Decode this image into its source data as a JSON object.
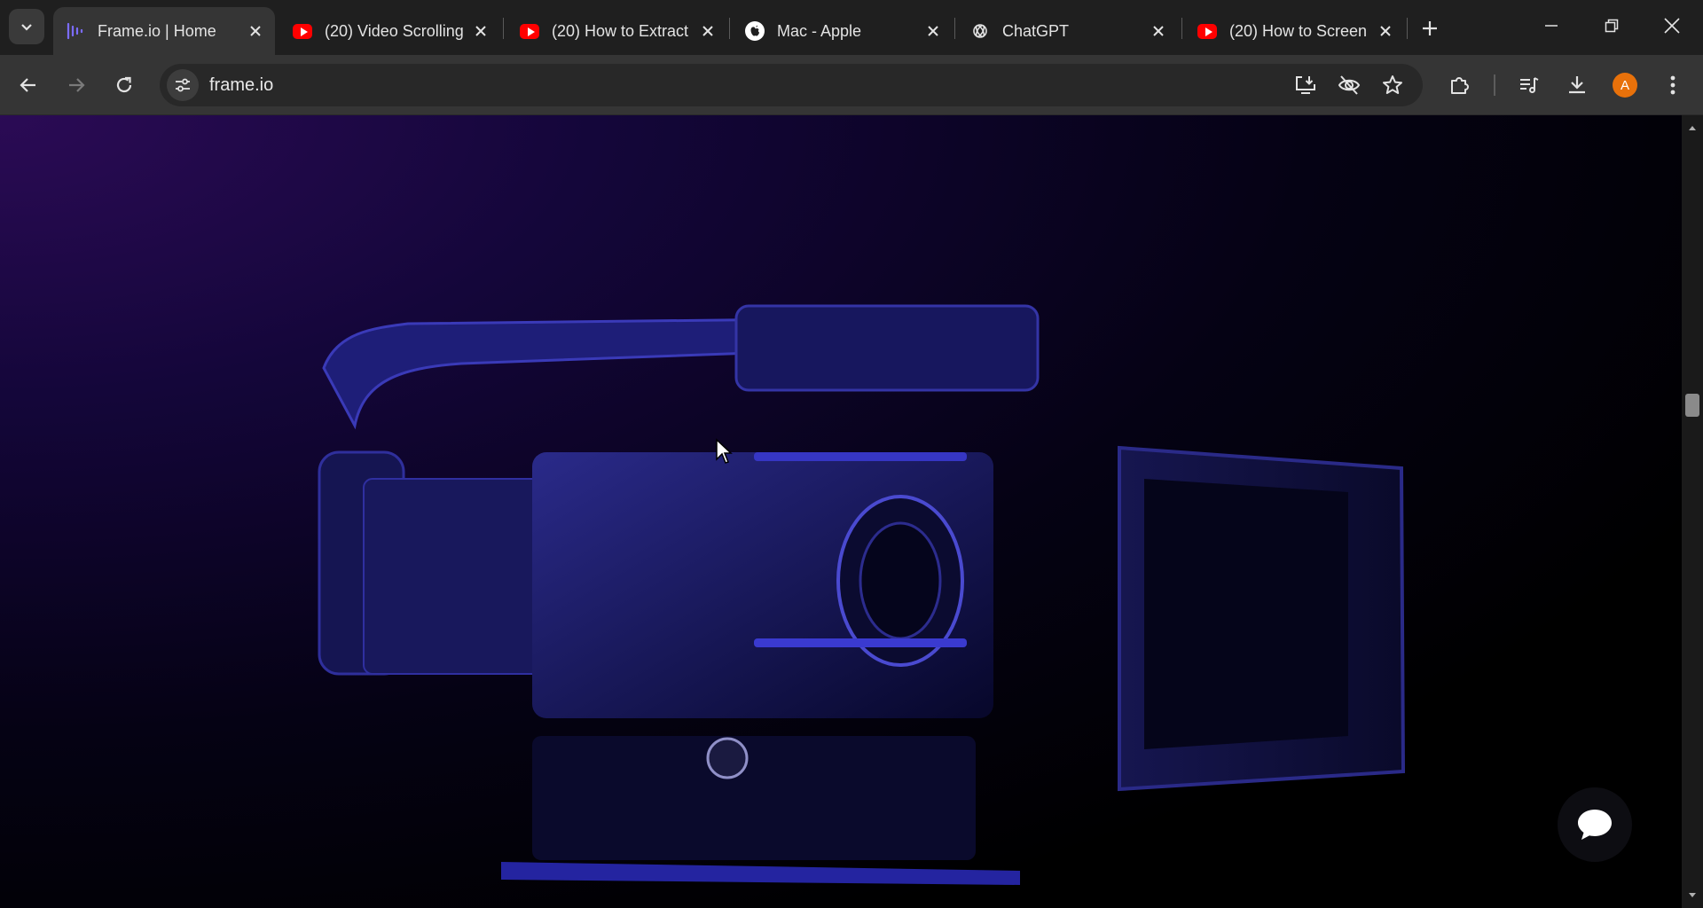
{
  "browser": {
    "tabs": [
      {
        "title": "Frame.io | Home",
        "favicon": "frameio-icon",
        "active": true
      },
      {
        "title": "(20) Video Scrolling",
        "favicon": "youtube-icon",
        "active": false
      },
      {
        "title": "(20) How to Extract",
        "favicon": "youtube-icon",
        "active": false
      },
      {
        "title": "Mac - Apple",
        "favicon": "apple-icon",
        "active": false
      },
      {
        "title": "ChatGPT",
        "favicon": "chatgpt-icon",
        "active": false
      },
      {
        "title": "(20) How to Screen",
        "favicon": "youtube-icon",
        "active": false
      }
    ],
    "address_bar": {
      "url": "frame.io"
    },
    "profile": {
      "initial": "A",
      "color": "#e8710a"
    }
  },
  "page": {
    "hero_image": "cinema-camera-rig",
    "accent": "#2b0b55",
    "chat_widget_icon": "chat-bubble-icon"
  }
}
